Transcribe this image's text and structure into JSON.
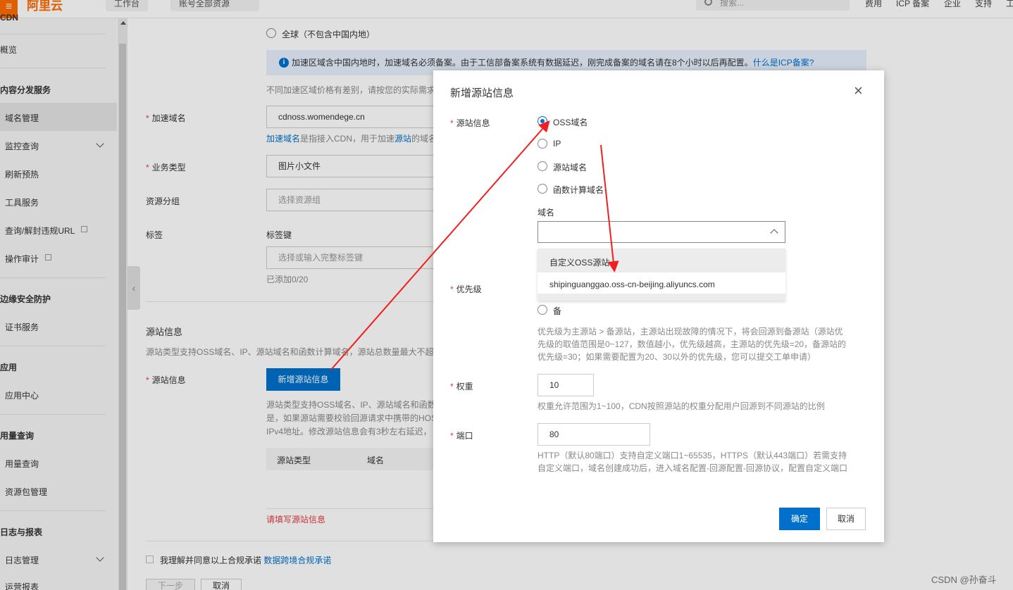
{
  "topbar": {
    "menu_icon": "≡",
    "logo": "阿里云",
    "tab_workbench": "工作台",
    "tab_account": "账号全部资源",
    "search_placeholder": "搜索...",
    "links": [
      "费用",
      "ICP 备案",
      "企业",
      "支持",
      "工"
    ]
  },
  "sidebar": {
    "header": "CDN",
    "items": [
      {
        "label": "概览",
        "type": "item"
      },
      {
        "label": "内容分发服务",
        "type": "section"
      },
      {
        "label": "域名管理",
        "type": "item"
      },
      {
        "label": "监控查询",
        "type": "item"
      },
      {
        "label": "刷新预热",
        "type": "item"
      },
      {
        "label": "工具服务",
        "type": "item"
      },
      {
        "label": "查询/解封违规URL",
        "type": "item"
      },
      {
        "label": "操作审计",
        "type": "item"
      },
      {
        "label": "边缘安全防护",
        "type": "section"
      },
      {
        "label": "证书服务",
        "type": "item"
      },
      {
        "label": "应用",
        "type": "section"
      },
      {
        "label": "应用中心",
        "type": "item"
      },
      {
        "label": "用量查询",
        "type": "section"
      },
      {
        "label": "用量查询",
        "type": "item"
      },
      {
        "label": "资源包管理",
        "type": "item"
      },
      {
        "label": "日志与报表",
        "type": "section"
      },
      {
        "label": "日志管理",
        "type": "item"
      },
      {
        "label": "运营报表",
        "type": "item"
      }
    ]
  },
  "form": {
    "region_global": "全球（不包含中国内地）",
    "info_text": "加速区域含中国内地时，加速域名必须备案。由于工信部备案系统有数据延迟，刚完成备案的域名请在8个小时以后再配置。",
    "info_link": "什么是ICP备案?",
    "price_hint": "不同加速区域价格有差别，请按您的实际需求",
    "domain_label": "加速域名",
    "domain_value": "cdnoss.womendege.cn",
    "domain_hint_link1": "加速域名",
    "domain_hint_mid": "是指接入CDN，用于加速",
    "domain_hint_link2": "源站",
    "domain_hint_tail": "的域名",
    "biz_label": "业务类型",
    "biz_value": "图片小文件",
    "group_label": "资源分组",
    "group_placeholder": "选择资源组",
    "tag_label": "标签",
    "tag_key_label": "标签键",
    "tag_placeholder": "选择或输入完整标签键",
    "tag_count": "已添加0/20",
    "origin_section": "源站信息",
    "origin_section_hint": "源站类型支持OSS域名、IP、源站域名和函数计算域名，源站总数量最大不超过",
    "origin_label": "源站信息",
    "add_origin_button": "新增源站信息",
    "origin_desc_1": "源站类型支持OSS域名、IP、源站域名和函数",
    "origin_desc_2": "是，如果源站需要校验回源请求中携带的HOS",
    "origin_desc_3": "IPv4地址。修改源站信息会有3秒左右延迟，",
    "table_col_type": "源站类型",
    "table_col_domain": "域名",
    "origin_error": "请填写源站信息",
    "agree_text": "我理解并同意以上合规承诺",
    "agree_link": "数据跨境合规承诺",
    "next_button": "下一步",
    "cancel_button": "取消"
  },
  "modal": {
    "title": "新增源站信息",
    "close_icon": "×",
    "origin_label": "源站信息",
    "options": [
      "OSS域名",
      "IP",
      "源站域名",
      "函数计算域名"
    ],
    "selected_option": "OSS域名",
    "domain_label": "域名",
    "dropdown_options": [
      "自定义OSS源站",
      "shipinguanggao.oss-cn-beijing.aliyuncs.com"
    ],
    "priority_label": "优先级",
    "priority_backup": "备",
    "priority_hint": [
      "优先级为主源站 > 备源站，主源站出现故障的情况下，将会回源到备源站（源站优",
      "先级的取值范围是0~127，数值越小，优先级越高，主源站的优先级=20，备源站的",
      "优先级=30；如果需要配置为20、30以外的优先级，您可以提交工单申请）"
    ],
    "weight_label": "权重",
    "weight_value": "10",
    "weight_hint": "权重允许范围为1~100，CDN按照源站的权重分配用户回源到不同源站的比例",
    "port_label": "端口",
    "port_value": "80",
    "port_hint": [
      "HTTP（默认80端口）支持自定义端口1~65535，HTTPS（默认443端口）若需支持",
      "自定义端口，域名创建成功后，进入域名配置-回源配置-回源协议，配置自定义端口"
    ],
    "confirm_button": "确定",
    "cancel_button": "取消"
  },
  "watermark": "CSDN @孙奋斗",
  "colors": {
    "brand": "#ff6a00",
    "primary": "#0070cc",
    "required": "#e4393c",
    "annotation_arrow": "#f02020"
  }
}
